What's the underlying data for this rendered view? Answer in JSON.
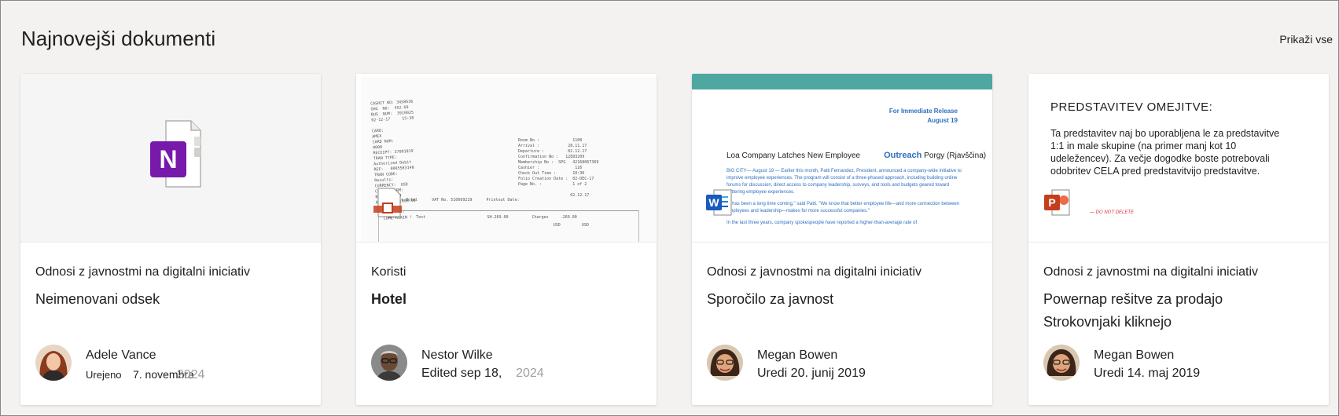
{
  "section": {
    "title": "Najnovejši dokumenti",
    "show_all": "Prikaži vse"
  },
  "cards": [
    {
      "notebook": "Odnosi z javnostmi na digitalni iniciativ",
      "title_lines": [
        "Neimenovani odsek"
      ],
      "author": "Adele Vance",
      "meta_prefix": "Urejeno",
      "meta_date": "7. novembra",
      "meta_faded": "2024",
      "app": "onenote-icon",
      "app_letter": "N",
      "app_color": "#7719aa"
    },
    {
      "notebook": "Koristi",
      "title_lines": [
        "Hotel"
      ],
      "author": "Nestor Wilke",
      "meta_prefix": "Edited sep 18,",
      "meta_faded": "2024",
      "receipt": {
        "left_lines": "CASHIT NO: 3458636\nGHG  NO:  452-69\nBUS  NUM:  3910025\n02-12-17     15:38\n\nCARD:\nAMEX\nCARD NUM:\n0000\nRECEIPT: 37001019\nTRAN TYPE:\nAuthorized Debit\nREF:   0005583148\nTRAN CODE:\nResults:\nCURRENCY:  USD\nCREDIT TERM:\nBalance:  0\nAMNT:     1008.00\n\n THANK YOU !\n   COME AGAIN !",
        "right_lines": "Room No :              1108\nArrival :            28.11.17\nDeparture :          02.12.17\nConfirmation No :   12893209\nMembership No :  SPG   42168067369\nCashier :               116\nCheck Out Time :       10:30\nFolio Creation Date :  02-DEC-17\nPage No. :             1 of 2\n\n                      02.12.17",
        "footer_line": "Tel Aviv Hotel      VAT No. 510669219      Printout Date:",
        "table_head": "Date        Text                          SH.269.00          Charges     .269.00",
        "table_row": "                                                                      USD         USD"
      },
      "app": "receipt-icon",
      "app_color": "#c43e1c"
    },
    {
      "notebook": "Odnosi z javnostmi na digitalni iniciativ",
      "title_lines": [
        "Sporočilo za javnost"
      ],
      "author": "Megan Bowen",
      "meta_prefix": "Uredi 20. junij 2019",
      "word": {
        "release_1": "For Immediate Release",
        "release_2": "August 19",
        "headline": "Loa Company Latches New Employee",
        "headline_blue": "Outreach",
        "headline_tail": "Porgy (Rjavščina)",
        "para_1": "BIG CITY— August 19 — Earlier this month, Patti Fernandez, President, announced a company-wide initiative to improve employee experiences. The program will consist of a three-phased approach, including building online forums for discussion, direct access to company leadership, surveys, and tools and budgets geared toward bettering employee experiences.",
        "para_2": "\"It has been a long time coming,\" said Patti. \"We know that better employee life—and more connection between employees and leadership—makes for more successful companies.\"",
        "para_3": "In the last three years, company spokespeople have reported a higher-than-average rate of"
      },
      "app": "word-icon",
      "app_letter": "W",
      "app_color": "#185abd"
    },
    {
      "notebook": "Odnosi z javnostmi na digitalni iniciativ",
      "title_lines": [
        "Powernap rešitve za prodajo",
        "Strokovnjaki kliknejo"
      ],
      "author": "Megan Bowen",
      "meta_prefix": "Uredi 14. maj 2019",
      "ppt": {
        "title": "PREDSTAVITEV  OMEJITVE:",
        "body": "Ta predstavitev naj bo uporabljena le za predstavitve 1:1 in male skupine (na primer manj kot 10 udeležencev). Za večje dogodke boste potrebovali odobritev CELA pred predstavitvijo predstavitve.",
        "note": "— DO NOT DELETE"
      },
      "app": "powerpoint-icon",
      "app_letter": "P",
      "app_color": "#c43e1c"
    }
  ]
}
